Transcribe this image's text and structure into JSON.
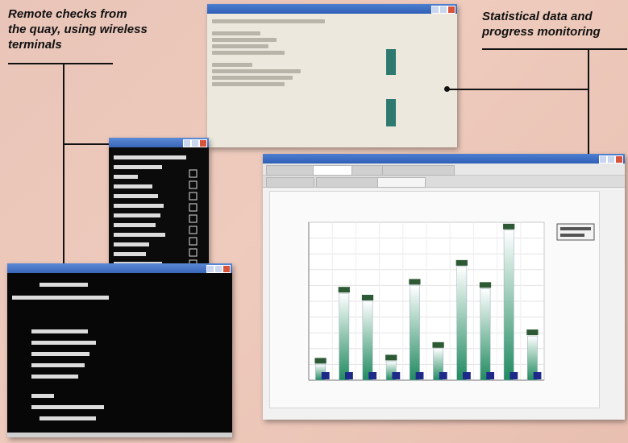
{
  "captions": {
    "left": [
      "Remote checks from",
      "the quay, using wireless",
      "terminals"
    ],
    "right": [
      "Statistical data and",
      "progress monitoring"
    ]
  },
  "colors": {
    "bar_fill_top": "#ffffff",
    "bar_fill_bottom": "#1f8a5f",
    "bar_label": "#2d5a34",
    "bar_base": "#1e2a8a",
    "teal": "#2f7a70"
  },
  "stats_window": {
    "title": ""
  },
  "progress_window": {
    "title": ""
  },
  "chart_data": {
    "type": "bar",
    "categories": [
      "",
      "",
      "",
      "",
      "",
      "",
      "",
      "",
      "",
      ""
    ],
    "values": [
      10,
      55,
      50,
      12,
      60,
      20,
      72,
      58,
      95,
      28
    ],
    "ylim": [
      0,
      100
    ],
    "grid": true,
    "legend": "top-right"
  }
}
